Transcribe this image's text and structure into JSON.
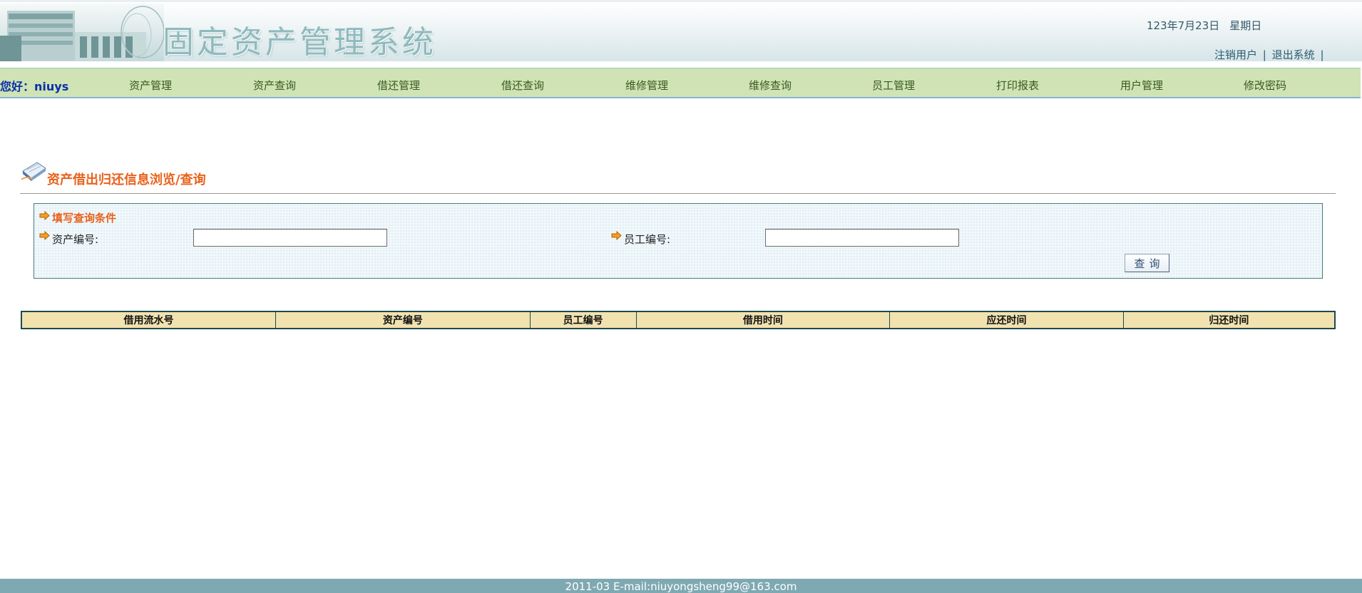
{
  "header": {
    "app_title": "固定资产管理系统",
    "date": "123年7月23日",
    "weekday": "星期日",
    "links": [
      {
        "label": "注销用户"
      },
      {
        "label": "退出系统"
      }
    ],
    "separator": "|"
  },
  "nav": {
    "greeting": "您好：niuys",
    "items": [
      {
        "label": "资产管理"
      },
      {
        "label": "资产查询"
      },
      {
        "label": "借还管理"
      },
      {
        "label": "借还查询"
      },
      {
        "label": "维修管理"
      },
      {
        "label": "维修查询"
      },
      {
        "label": "员工管理"
      },
      {
        "label": "打印报表"
      },
      {
        "label": "用户管理"
      },
      {
        "label": "修改密码"
      }
    ]
  },
  "section": {
    "title": "资产借出归还信息浏览/查询"
  },
  "query": {
    "panel_title": "填写查询条件",
    "asset_label": "资产编号:",
    "asset_value": "",
    "employee_label": "员工编号:",
    "employee_value": "",
    "button_label": "查询"
  },
  "table": {
    "columns": [
      "借用流水号",
      "资产编号",
      "员工编号",
      "借用时间",
      "应还时间",
      "归还时间"
    ],
    "rows": []
  },
  "footer": {
    "text": "2011-03 E-mail:niuyongsheng99@163.com"
  },
  "colors": {
    "nav_bg": "#cfe3b5",
    "title_orange": "#e8621c",
    "table_header_bg": "#f2e2b0",
    "footer_bg": "#7fa9b2",
    "greeting_blue": "#0b2fa8"
  }
}
